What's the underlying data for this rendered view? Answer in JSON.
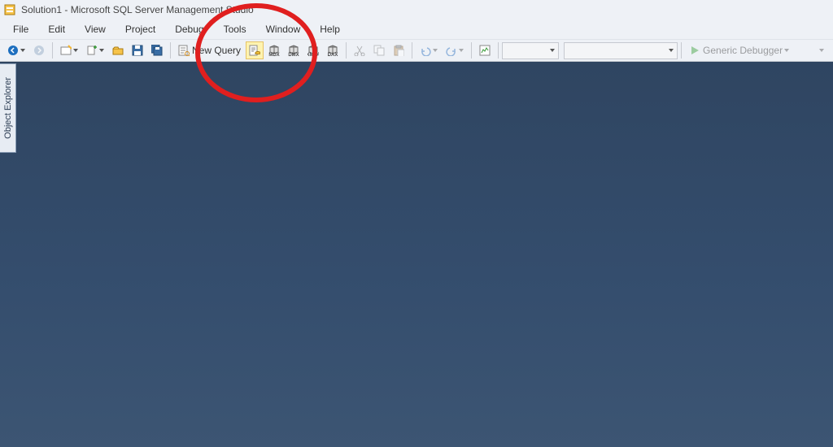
{
  "title": "Solution1 - Microsoft SQL Server Management Studio",
  "menus": {
    "file": "File",
    "edit": "Edit",
    "view": "View",
    "project": "Project",
    "debug": "Debug",
    "tools": "Tools",
    "window": "Window",
    "help": "Help"
  },
  "toolbar": {
    "new_query": "New Query",
    "query_types": {
      "mdx": "MDX",
      "dmx": "DMX",
      "xmla": "XMLA",
      "dax": "DAX"
    },
    "debugger_label": "Generic Debugger"
  },
  "sidebar": {
    "object_explorer": "Object Explorer"
  }
}
